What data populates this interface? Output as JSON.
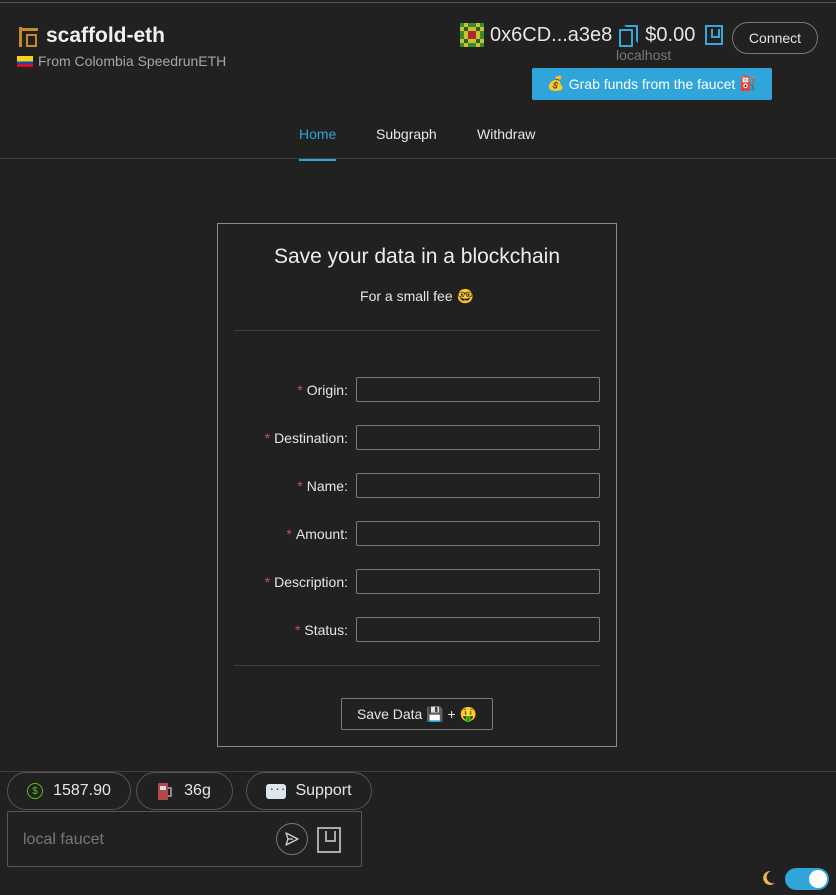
{
  "header": {
    "title": "scaffold-eth",
    "subtitle": "From Colombia SpeedrunETH",
    "address": "0x6CD...a3e8",
    "balance": "$0.00",
    "network": "localhost",
    "connect_label": "Connect",
    "faucet_label": "Grab funds from the faucet",
    "faucet_emoji_left": "💰",
    "faucet_emoji_right": "⛽"
  },
  "nav": {
    "tabs": [
      {
        "label": "Home",
        "active": true
      },
      {
        "label": "Subgraph",
        "active": false
      },
      {
        "label": "Withdraw",
        "active": false
      }
    ]
  },
  "card": {
    "title": "Save your data in a blockchain",
    "subtitle": "For a small fee",
    "subtitle_emoji": "🤓",
    "fields": [
      {
        "label": "Origin",
        "value": ""
      },
      {
        "label": "Destination",
        "value": ""
      },
      {
        "label": "Name",
        "value": ""
      },
      {
        "label": "Amount",
        "value": ""
      },
      {
        "label": "Description",
        "value": ""
      },
      {
        "label": "Status",
        "value": ""
      }
    ],
    "save_label": "Save Data 💾 + 🤑"
  },
  "footer": {
    "eth_price": "1587.90",
    "gas_price": "36g",
    "support_label": "Support",
    "faucet_placeholder": "local faucet"
  },
  "theme": {
    "accent": "#2fa5d9",
    "mode": "dark"
  }
}
